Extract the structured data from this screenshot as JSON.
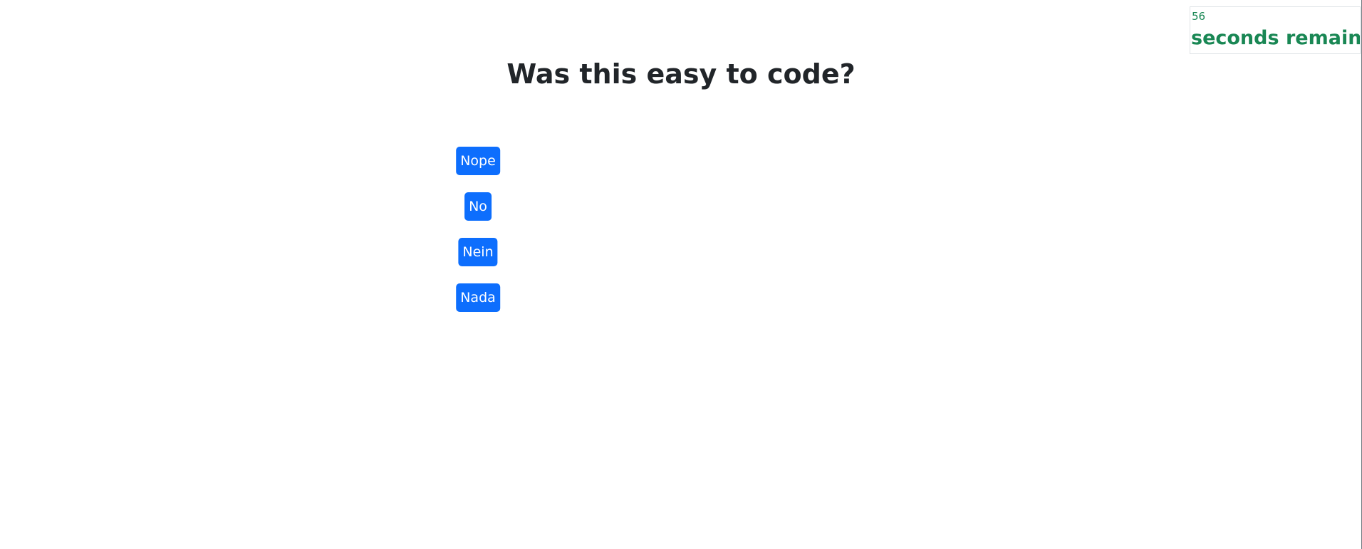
{
  "timer": {
    "count": "56",
    "label": "seconds remaining",
    "color": "#198754"
  },
  "question": {
    "title": "Was this easy to code?"
  },
  "answers": [
    {
      "label": "Nope"
    },
    {
      "label": "No"
    },
    {
      "label": "Nein"
    },
    {
      "label": "Nada"
    }
  ],
  "colors": {
    "button_bg": "#0d6efd",
    "button_text": "#ffffff",
    "heading": "#212529"
  }
}
